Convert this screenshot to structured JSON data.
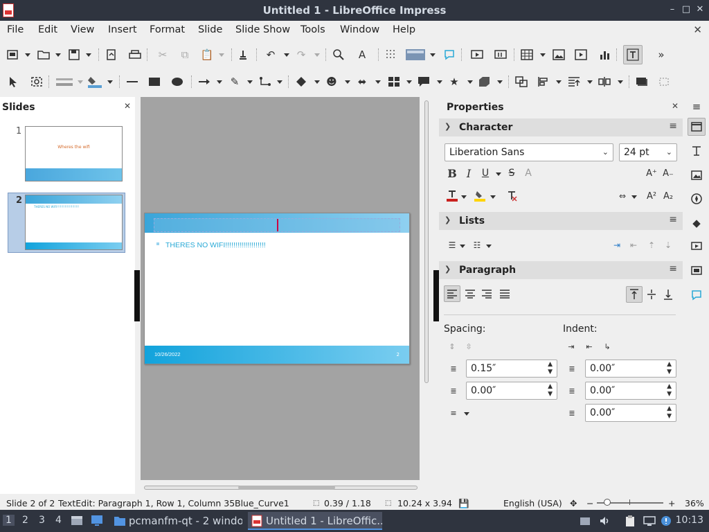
{
  "window": {
    "title": "Untitled 1 - LibreOffice Impress",
    "buttons": {
      "minimize": "–",
      "restore": "□",
      "close": "✕"
    }
  },
  "menu": [
    "File",
    "Edit",
    "View",
    "Insert",
    "Format",
    "Slide",
    "Slide Show",
    "Tools",
    "Window",
    "Help"
  ],
  "menu_close": "✕",
  "slides_pane": {
    "title": "Slides",
    "close": "✕",
    "slides": [
      {
        "number": "1",
        "title_text": "Wheres the wifi"
      },
      {
        "number": "2",
        "title_text": "THERES NO WIFI!!!!!!!!!!!!!!!!!!!!"
      }
    ]
  },
  "slide": {
    "bullet_text": "THERES NO WIFI!!!!!!!!!!!!!!!!!!!!",
    "date": "10/26/2022",
    "page_number": "2"
  },
  "properties": {
    "title": "Properties",
    "close": "✕",
    "sections": {
      "character": "Character",
      "lists": "Lists",
      "paragraph": "Paragraph"
    },
    "font_name": "Liberation Sans",
    "font_size": "24 pt",
    "spacing_label": "Spacing:",
    "indent_label": "Indent:",
    "spacing_above": "0.15″",
    "spacing_below": "0.00″",
    "indent_before": "0.00″",
    "indent_after": "0.00″",
    "indent_first": "0.00″"
  },
  "status": {
    "slide": "Slide 2 of 2",
    "edit": "TextEdit: Paragraph 1, Row 1, Column 35",
    "master": "Blue_Curve1",
    "position": "0.39 / 1.18",
    "size": "10.24 x 3.94",
    "language": "English (USA)",
    "zoom_minus": "−",
    "zoom_plus": "+",
    "zoom": "36%"
  },
  "taskbar": {
    "workspaces": [
      "1",
      "2",
      "3",
      "4"
    ],
    "tasks": [
      {
        "label": "pcmanfm-qt - 2 windo..."
      },
      {
        "label": "Untitled 1 - LibreOffic..."
      }
    ],
    "clock": "10:13"
  },
  "colors": {
    "accent": "#29a9d6",
    "title_bar": "#2f343f"
  }
}
